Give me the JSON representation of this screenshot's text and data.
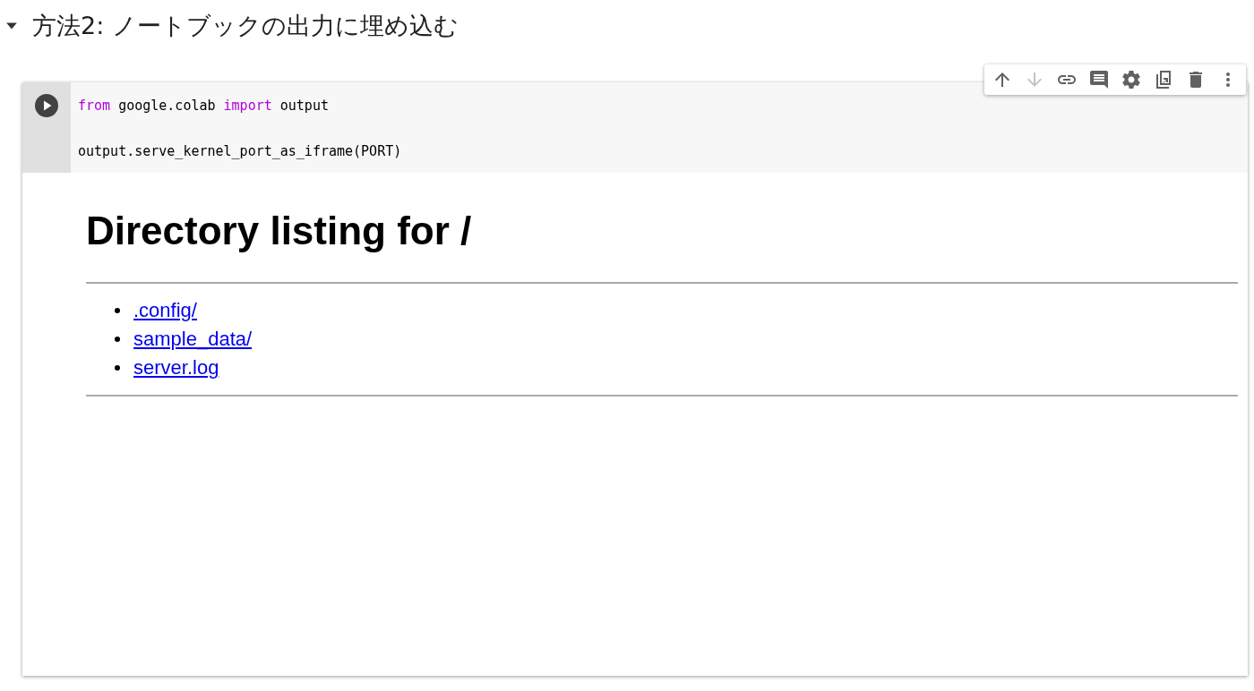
{
  "section": {
    "title": "方法2: ノートブックの出力に埋め込む",
    "expanded": true
  },
  "toolbar": [
    {
      "kind": "move-up",
      "disabled": false
    },
    {
      "kind": "move-down",
      "disabled": true
    },
    {
      "kind": "link",
      "disabled": false
    },
    {
      "kind": "comment",
      "disabled": false
    },
    {
      "kind": "settings",
      "disabled": false
    },
    {
      "kind": "mirror",
      "disabled": false
    },
    {
      "kind": "delete",
      "disabled": false
    },
    {
      "kind": "more",
      "disabled": false
    }
  ],
  "code": {
    "lines": [
      [
        {
          "text": "from",
          "kind": "keyword"
        },
        {
          "text": " google.colab ",
          "kind": "plain"
        },
        {
          "text": "import",
          "kind": "keyword"
        },
        {
          "text": " output",
          "kind": "plain"
        }
      ],
      [
        {
          "text": "output.serve_kernel_port_as_iframe(PORT)",
          "kind": "plain"
        }
      ]
    ]
  },
  "output": {
    "heading": "Directory listing for /",
    "links": [
      ".config/",
      "sample_data/",
      "server.log"
    ]
  }
}
